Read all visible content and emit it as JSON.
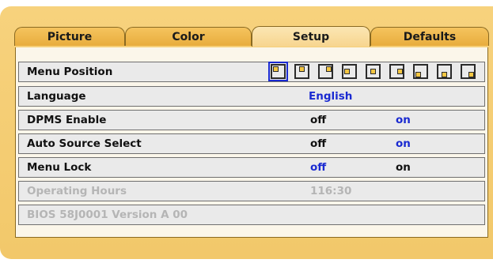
{
  "tabs": [
    {
      "label": "Picture",
      "active": false
    },
    {
      "label": "Color",
      "active": false
    },
    {
      "label": "Setup",
      "active": true
    },
    {
      "label": "Defaults",
      "active": false
    }
  ],
  "setup": {
    "menu_position": {
      "label": "Menu Position",
      "selected_index": 0,
      "option_count": 9
    },
    "language": {
      "label": "Language",
      "value": "English"
    },
    "dpms": {
      "label": "DPMS Enable",
      "options": [
        "off",
        "on"
      ],
      "selected": "on"
    },
    "auto_source": {
      "label": "Auto Source Select",
      "options": [
        "off",
        "on"
      ],
      "selected": "on"
    },
    "menu_lock": {
      "label": "Menu Lock",
      "options": [
        "off",
        "on"
      ],
      "selected": "off"
    },
    "operating_hours": {
      "label": "Operating Hours",
      "value": "116:30"
    },
    "bios": {
      "label": "BIOS 58J0001 Version A 00"
    }
  },
  "colors": {
    "selected": "#1a2ad1",
    "disabled": "#b5b5b5",
    "frame": "#f2c86a"
  }
}
